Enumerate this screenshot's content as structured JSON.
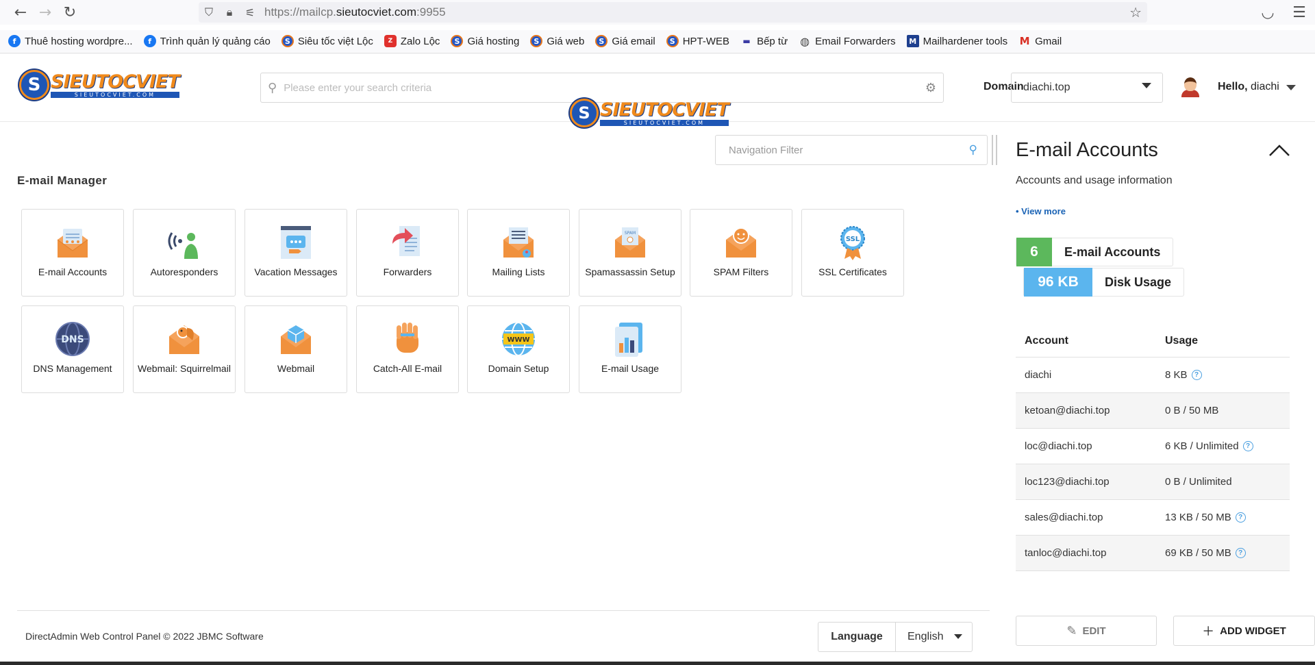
{
  "browser": {
    "url_prefix": "https://mailcp.",
    "url_domain": "sieutocviet.com",
    "url_suffix": ":9955",
    "bookmarks": [
      {
        "label": "Thuê hosting wordpre...",
        "icon": "facebook-icon"
      },
      {
        "label": "Trình quản lý quảng cáo",
        "icon": "facebook-icon"
      },
      {
        "label": "Siêu tốc việt Lộc",
        "icon": "sieutocviet-icon"
      },
      {
        "label": "Zalo Lộc",
        "icon": "zalo-icon"
      },
      {
        "label": "Giá hosting",
        "icon": "sieutocviet-icon"
      },
      {
        "label": "Giá web",
        "icon": "sieutocviet-icon"
      },
      {
        "label": "Giá email",
        "icon": "sieutocviet-icon"
      },
      {
        "label": "HPT-WEB",
        "icon": "sieutocviet-icon"
      },
      {
        "label": "Bếp từ",
        "icon": "bep-icon"
      },
      {
        "label": "Email Forwarders",
        "icon": "globe-icon"
      },
      {
        "label": "Mailhardener tools",
        "icon": "mailhardener-icon"
      },
      {
        "label": "Gmail",
        "icon": "gmail-icon"
      }
    ]
  },
  "header": {
    "logo_text": "SIEUTOCVIET",
    "logo_sub": "SIEUTOCVIET.COM",
    "search_placeholder": "Please enter your search criteria",
    "domain_label": "Domain",
    "domain_value": "diachi.top",
    "hello_prefix": "Hello,",
    "username": "diachi"
  },
  "main": {
    "nav_filter_placeholder": "Navigation Filter",
    "section_title": "E-mail Manager",
    "tiles": [
      {
        "label": "E-mail Accounts",
        "icon": "email-accounts-icon"
      },
      {
        "label": "Autoresponders",
        "icon": "autoresponders-icon"
      },
      {
        "label": "Vacation Messages",
        "icon": "vacation-messages-icon"
      },
      {
        "label": "Forwarders",
        "icon": "forwarders-icon"
      },
      {
        "label": "Mailing Lists",
        "icon": "mailing-lists-icon"
      },
      {
        "label": "Spamassassin Setup",
        "icon": "spamassassin-icon"
      },
      {
        "label": "SPAM Filters",
        "icon": "spam-filters-icon"
      },
      {
        "label": "SSL Certificates",
        "icon": "ssl-certificates-icon"
      },
      {
        "label": "DNS Management",
        "icon": "dns-management-icon"
      },
      {
        "label": "Webmail: Squirrelmail",
        "icon": "squirrelmail-icon"
      },
      {
        "label": "Webmail",
        "icon": "webmail-icon"
      },
      {
        "label": "Catch-All E-mail",
        "icon": "catch-all-icon"
      },
      {
        "label": "Domain Setup",
        "icon": "domain-setup-icon"
      },
      {
        "label": "E-mail Usage",
        "icon": "email-usage-icon"
      }
    ]
  },
  "widget": {
    "title": "E-mail Accounts",
    "subtitle": "Accounts and usage information",
    "view_more": "• View more",
    "stats": [
      {
        "value": "6",
        "label": "E-mail Accounts",
        "color": "#5cb85c"
      },
      {
        "value": "96 KB",
        "label": "Disk Usage",
        "color": "#5bb5ee"
      }
    ],
    "table_headers": {
      "account": "Account",
      "usage": "Usage"
    },
    "accounts": [
      {
        "account": "diachi",
        "usage": "8 KB",
        "help": true
      },
      {
        "account": "ketoan@diachi.top",
        "usage": "0 B / 50 MB",
        "help": false
      },
      {
        "account": "loc@diachi.top",
        "usage": "6 KB / Unlimited",
        "help": true
      },
      {
        "account": "loc123@diachi.top",
        "usage": "0 B / Unlimited",
        "help": false
      },
      {
        "account": "sales@diachi.top",
        "usage": "13 KB / 50 MB",
        "help": true
      },
      {
        "account": "tanloc@diachi.top",
        "usage": "69 KB / 50 MB",
        "help": true
      }
    ],
    "edit_label": "EDIT",
    "add_widget_label": "ADD WIDGET"
  },
  "footer": {
    "copyright": "DirectAdmin Web Control Panel © 2022 JBMC Software",
    "language_label": "Language",
    "language_value": "English"
  }
}
